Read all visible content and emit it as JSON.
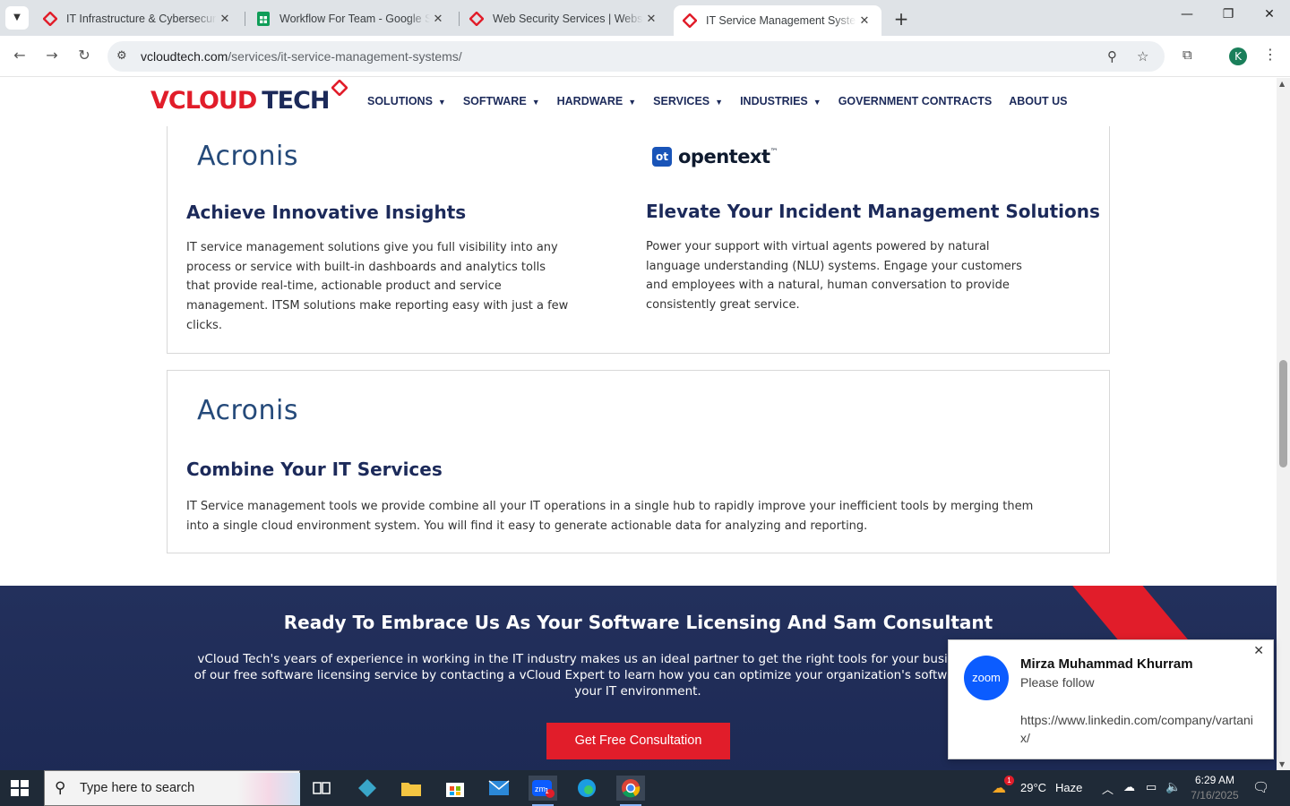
{
  "browser": {
    "tabs": [
      {
        "title": "IT Infrastructure & Cybersecurity",
        "active": false
      },
      {
        "title": "Workflow For Team - Google Sheets",
        "active": false
      },
      {
        "title": "Web Security Services | Website",
        "active": false
      },
      {
        "title": "IT Service Management Systems",
        "active": true
      }
    ],
    "url_domain": "vcloudtech.com",
    "url_path": "/services/it-service-management-systems/",
    "profile_initial": "K"
  },
  "site": {
    "logo_main": "VCLOUD",
    "logo_second": "TECH",
    "nav": [
      {
        "label": "SOLUTIONS",
        "has_dropdown": true
      },
      {
        "label": "SOFTWARE",
        "has_dropdown": true
      },
      {
        "label": "HARDWARE",
        "has_dropdown": true
      },
      {
        "label": "SERVICES",
        "has_dropdown": true
      },
      {
        "label": "INDUSTRIES",
        "has_dropdown": true
      },
      {
        "label": "GOVERNMENT CONTRACTS",
        "has_dropdown": false
      },
      {
        "label": "ABOUT US",
        "has_dropdown": false
      }
    ]
  },
  "cards": [
    {
      "brand": "Acronis",
      "heading": "Achieve Innovative Insights",
      "body": "IT service management solutions give you full visibility into any process or service with built-in dashboards and analytics tolls that provide real-time, actionable product and service management. ITSM solutions make reporting easy with just a few clicks."
    },
    {
      "brand": "opentext",
      "brand_trademark": "™",
      "brand_mark": "ot",
      "heading": "Elevate Your Incident Management Solutions",
      "body": "Power your support with virtual agents powered by natural language understanding (NLU) systems. Engage your customers and employees with a natural, human conversation to provide consistently great service."
    },
    {
      "brand": "Acronis",
      "heading": "Combine Your IT Services",
      "body": "IT Service management tools we provide combine all your IT operations in a single hub to rapidly improve your inefficient tools by merging them into a single cloud environment system. You will find it easy to generate actionable data for analyzing and reporting."
    }
  ],
  "cta": {
    "title": "Ready To Embrace Us As Your Software Licensing And Sam Consultant",
    "body": "vCloud Tech's years of experience in working in the IT industry makes us an ideal partner to get the right tools for your business. Take advantage of our free software licensing service by contacting a vCloud Expert to learn how you can optimize your organization's software investment across your IT environment.",
    "button": "Get Free Consultation"
  },
  "toast": {
    "app": "zoom",
    "sender": "Mirza Muhammad Khurram",
    "message": "Please follow",
    "link": "https://www.linkedin.com/company/vartanix/"
  },
  "taskbar": {
    "search_placeholder": "Type here to search",
    "weather_temp": "29°C",
    "weather_desc": "Haze",
    "weather_badge": "1",
    "zoom_badge": "1",
    "time": "6:29 AM",
    "date": "7/16/2025"
  },
  "colors": {
    "navy": "#1c2a5a",
    "brand_red": "#e11d2a",
    "cta_bg": "#23305c",
    "zoom_blue": "#0b5cff"
  }
}
